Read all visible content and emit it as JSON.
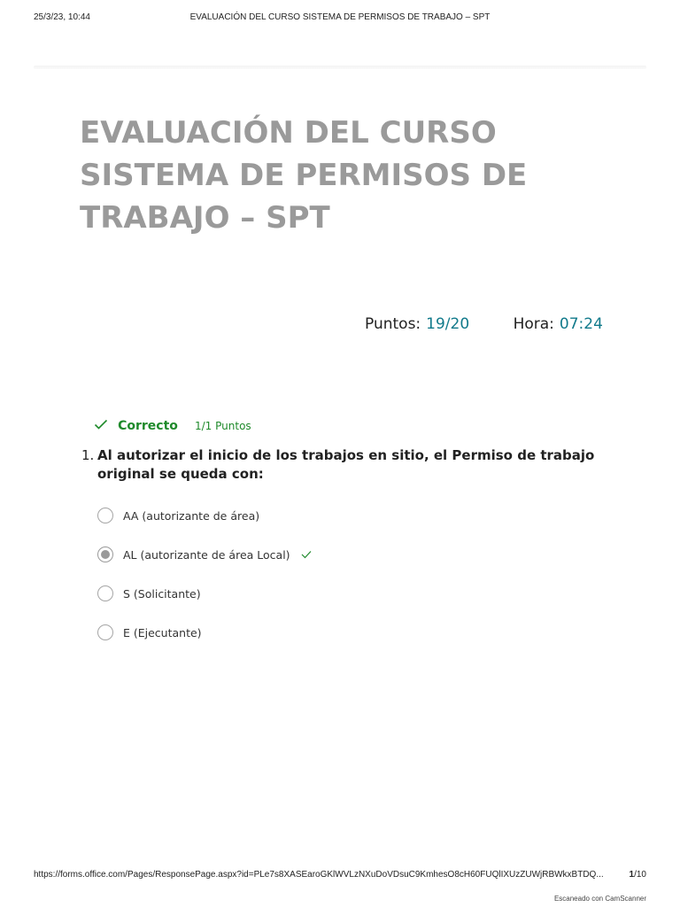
{
  "print_header": {
    "date": "25/3/23, 10:44",
    "title": "EVALUACIÓN DEL CURSO SISTEMA DE PERMISOS DE TRABAJO – SPT"
  },
  "form": {
    "title": "EVALUACIÓN DEL CURSO SISTEMA DE PERMISOS DE TRABAJO – SPT",
    "points_label": "Puntos:",
    "points_value": "19/20",
    "time_label": "Hora:",
    "time_value": "07:24"
  },
  "question_1": {
    "status": "Correcto",
    "points": "1/1 Puntos",
    "number": "1.",
    "text": "Al autorizar el inicio de los trabajos en sitio, el Permiso de trabajo original se queda con:",
    "options": [
      {
        "label": "AA (autorizante de área)",
        "selected": false
      },
      {
        "label": "AL (autorizante de área Local)",
        "selected": true
      },
      {
        "label": "S (Solicitante)",
        "selected": false
      },
      {
        "label": "E (Ejecutante)",
        "selected": false
      }
    ]
  },
  "footer": {
    "url": "https://forms.office.com/Pages/ResponsePage.aspx?id=PLe7s8XASEaroGKlWVLzNXuDoVDsuC9KmhesO8cH60FUQlIXUzZUWjRBWkxBTDQ...",
    "page_current": "1",
    "page_total": "/10",
    "scanner": "Escaneado con CamScanner"
  },
  "colors": {
    "title_gray": "#9a9a9a",
    "teal_value": "#117a8b",
    "correct_green": "#1f8a2b"
  },
  "icons": {
    "status": "check-icon",
    "selected_correct": "check-icon"
  }
}
